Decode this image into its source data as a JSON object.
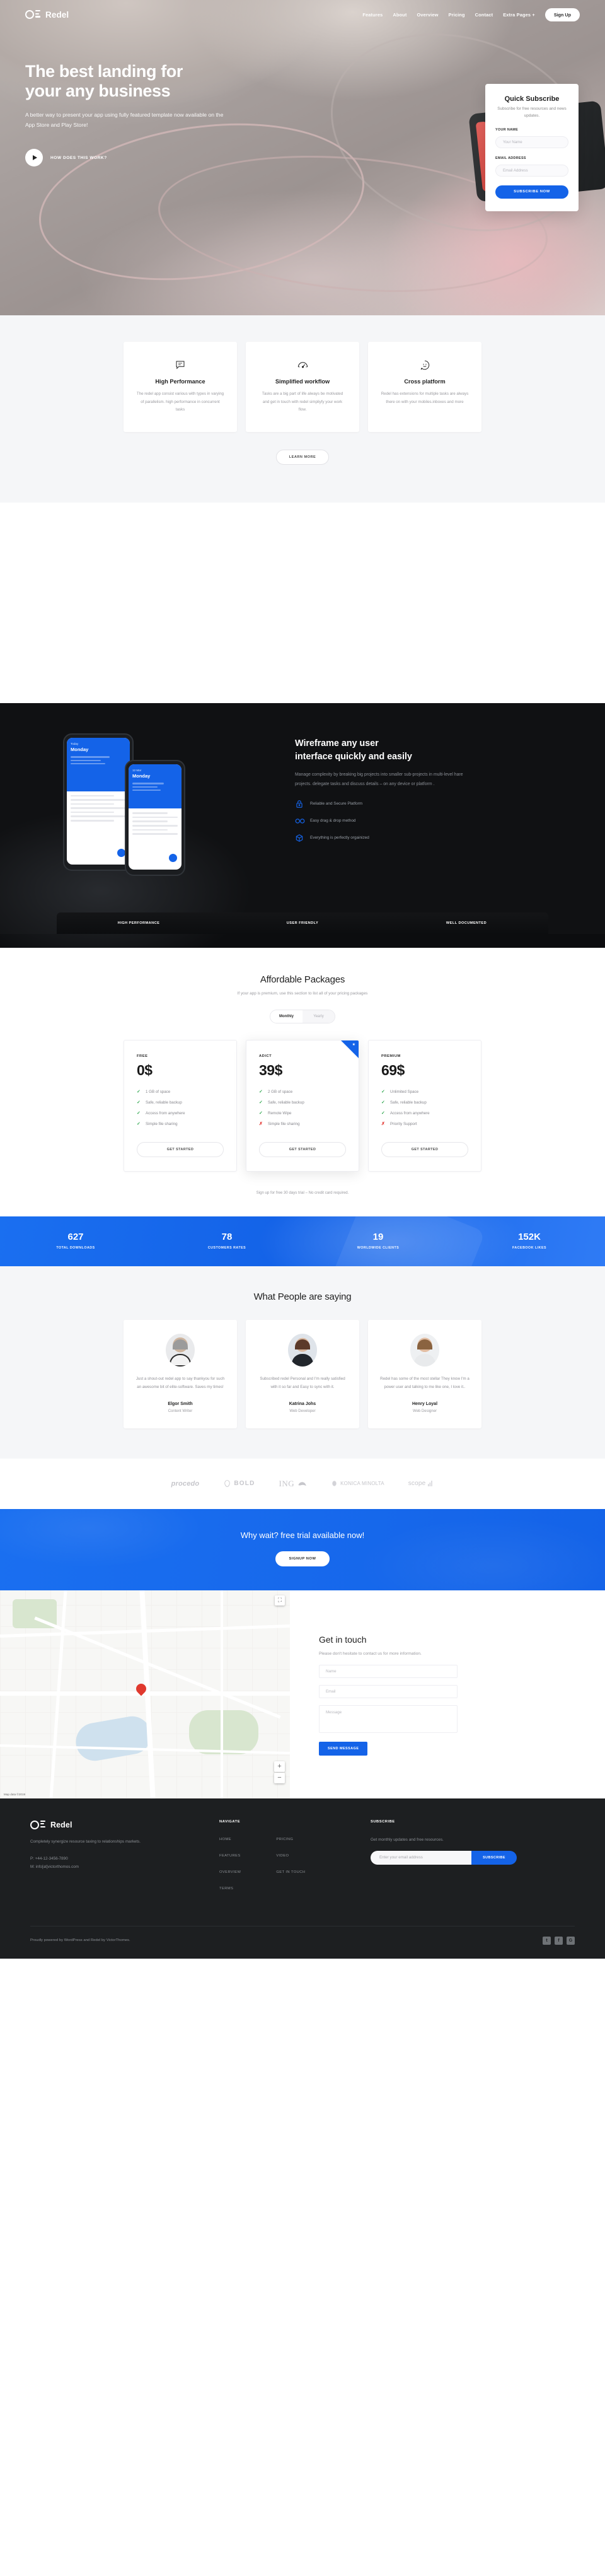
{
  "brand": {
    "name": "Redel"
  },
  "nav": {
    "links": [
      "Features",
      "About",
      "Overview",
      "Pricing",
      "Contact",
      "Extra Pages +"
    ],
    "signup_label": "Sign Up"
  },
  "hero": {
    "title_line1": "The best landing for",
    "title_line2": "your any business",
    "subtitle": "A better way to present your app using fully featured template now available on the App Store and Play Store!",
    "cta_label": "HOW DOES THIS WORK?"
  },
  "subscribe_card": {
    "title": "Quick Subscribe",
    "subtitle": "Subscribe for free resources and news updates.",
    "name_label": "YOUR NAME",
    "name_placeholder": "Your Name",
    "email_label": "EMAIL ADDRESS",
    "email_placeholder": "Email Address",
    "button_label": "SUBSCRIBE NOW"
  },
  "features": {
    "learn_more_label": "LEARN MORE",
    "cards": [
      {
        "icon": "chat-bubble-icon",
        "title": "High Performance",
        "text": "The redel app consist various with types in varying of parallelism. high performance in concurrent tasks"
      },
      {
        "icon": "speedometer-icon",
        "title": "Simplified workflow",
        "text": "Tasks are a big part of life always be motivated and get in touch with redel simpliyfy your work flow."
      },
      {
        "icon": "smiley-bubble-icon",
        "title": "Cross platform",
        "text": "Redel has extensions for multiple tasks are always there on with your mobiles.inboxes and more"
      }
    ]
  },
  "wireframe": {
    "title_line1": "Wireframe any user",
    "title_line2": "interface quickly and easily",
    "subtitle": "Manage complexity by breaking big projects into smaller sub-projects in multi-level hare projects. delegate tasks and discuss details – on any device or platform .",
    "list": [
      {
        "icon": "lock-icon",
        "text": "Reliable and Secure Platform"
      },
      {
        "icon": "infinity-icon",
        "text": "Easy drag & drop method"
      },
      {
        "icon": "box-icon",
        "text": "Everything is perfectly orgainized"
      }
    ],
    "tabs": [
      "HIGH PERFORMANCE",
      "USER FRIENDLY",
      "WELL DOCUMENTED"
    ],
    "phone_big": {
      "label": "Today",
      "day": "Monday"
    },
    "phone_small": {
      "label": "12 Mar",
      "day": "Monday"
    }
  },
  "pricing": {
    "title": "Affordable Packages",
    "subtitle": "If your app is premium, use this section to list all of your pricing packages",
    "toggle": {
      "monthly": "Monthly",
      "yearly": "Yearly"
    },
    "trial_note": "Sign up for free 30 days trial – No credit card required.",
    "plans": [
      {
        "name": "FREE",
        "price": "0$",
        "featured": false,
        "button_label": "GET STARTED",
        "features": [
          {
            "ok": true,
            "text": "1 GB of space"
          },
          {
            "ok": true,
            "text": "Safe, reliable backup"
          },
          {
            "ok": true,
            "text": "Access from anywhere"
          },
          {
            "ok": true,
            "text": "Simple file sharing"
          }
        ]
      },
      {
        "name": "ADICT",
        "price": "39$",
        "featured": true,
        "button_label": "GET STARTED",
        "features": [
          {
            "ok": true,
            "text": "2 GB of space"
          },
          {
            "ok": true,
            "text": "Safe, reliable backup"
          },
          {
            "ok": true,
            "text": "Remote Wipe"
          },
          {
            "ok": false,
            "text": "Simple file sharing"
          }
        ]
      },
      {
        "name": "PREMIUM",
        "price": "69$",
        "featured": false,
        "button_label": "GET STARTED",
        "features": [
          {
            "ok": true,
            "text": "Unlimited Space"
          },
          {
            "ok": true,
            "text": "Safe, reliable backup"
          },
          {
            "ok": true,
            "text": "Access from anywhere"
          },
          {
            "ok": false,
            "text": "Priority Support"
          }
        ]
      }
    ]
  },
  "stats": [
    {
      "value": "627",
      "label": "TOTAL DOWNLOADS"
    },
    {
      "value": "78",
      "label": "CUSTOMERS RATES"
    },
    {
      "value": "19",
      "label": "WORLDWIDE CLIENTS"
    },
    {
      "value": "152K",
      "label": "FACEBOOK LIKES"
    }
  ],
  "testimonials": {
    "title": "What People are saying",
    "items": [
      {
        "text": "Just a shout-out redel app to say thankyou for such an awesome bit of elite-software. Saves my times!",
        "name": "Elgor Smith",
        "role": "Content Writer"
      },
      {
        "text": "Subscribed redel Personal and I'm really satisfied with it so far and Easy to sync with it.",
        "name": "Katrina Johs",
        "role": "Web Developer"
      },
      {
        "text": "Redel has some of the most stellar They know I'm a power user and talking to me like one, I love it..",
        "name": "Henry Loyal",
        "role": "Web Designer"
      }
    ]
  },
  "logos": [
    "procedo",
    "BOLD",
    "ING",
    "KONICA MINOLTA",
    "scope"
  ],
  "cta": {
    "title": "Why wait? free trial available now!",
    "button_label": "SIGNUP NOW"
  },
  "contact": {
    "title": "Get in touch",
    "subtitle": "Please don't hesitate to contact us for more information.",
    "name_placeholder": "Name",
    "email_placeholder": "Email",
    "message_placeholder": "Message",
    "button_label": "SEND MESSAGE",
    "map_attribution": "Map data ©2019"
  },
  "footer": {
    "description": "Completely synergize resource taxing to relationships markets.",
    "phone": "P: +44-12-3456-7890",
    "mail": "M: info[at]victorthomos.com",
    "navigate_heading": "NAVIGATE",
    "navigate_col1": [
      "HOME",
      "FEATURES",
      "OVERVIEW",
      "TERMS"
    ],
    "navigate_col2": [
      "PRICING",
      "VIDEO",
      "GET IN TOUCH"
    ],
    "subscribe_heading": "SUBSCRIBE",
    "subscribe_desc": "Get monthly updates and free resources.",
    "email_placeholder": "Enter your email address",
    "subscribe_button": "SUBSCRIBE",
    "copyright": "Proudly powered by WordPress and Redel by VictorThomes.",
    "socials": [
      "twitter-icon",
      "facebook-icon",
      "google-plus-icon"
    ]
  },
  "colors": {
    "accent": "#1463e8",
    "dark": "#101113",
    "footer": "#1d1f21",
    "muted": "#9a9a9f"
  }
}
